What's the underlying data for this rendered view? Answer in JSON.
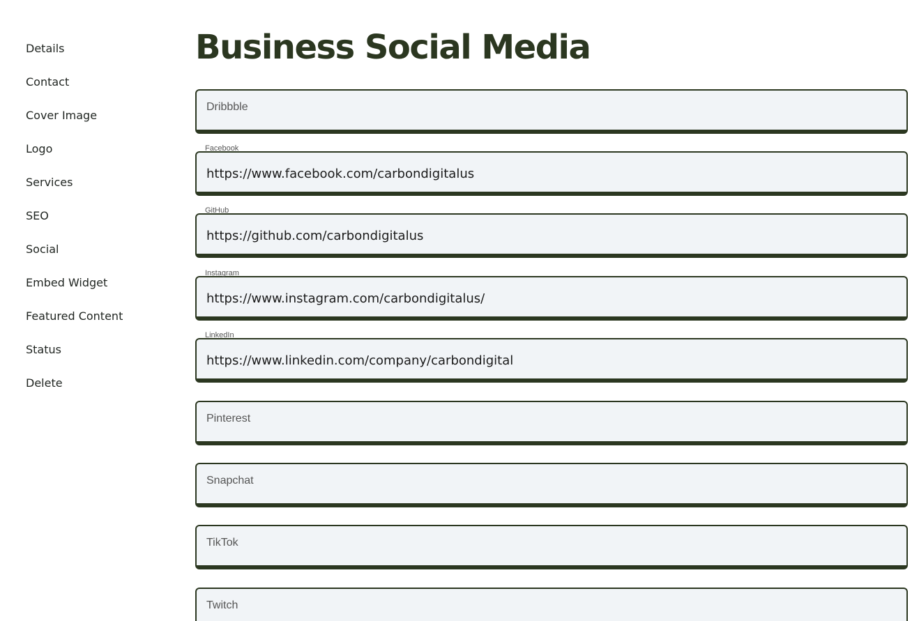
{
  "sidebar": {
    "items": [
      {
        "label": "Details"
      },
      {
        "label": "Contact"
      },
      {
        "label": "Cover Image"
      },
      {
        "label": "Logo"
      },
      {
        "label": "Services"
      },
      {
        "label": "SEO"
      },
      {
        "label": "Social"
      },
      {
        "label": "Embed Widget"
      },
      {
        "label": "Featured Content"
      },
      {
        "label": "Status"
      },
      {
        "label": "Delete"
      }
    ]
  },
  "main": {
    "title": "Business Social Media",
    "fields": [
      {
        "label": "Dribbble",
        "placeholder": "Dribbble",
        "value": ""
      },
      {
        "label": "Facebook",
        "placeholder": "Facebook",
        "value": "https://www.facebook.com/carbondigitalus"
      },
      {
        "label": "GitHub",
        "placeholder": "GitHub",
        "value": "https://github.com/carbondigitalus"
      },
      {
        "label": "Instagram",
        "placeholder": "Instagram",
        "value": "https://www.instagram.com/carbondigitalus/"
      },
      {
        "label": "LinkedIn",
        "placeholder": "LinkedIn",
        "value": "https://www.linkedin.com/company/carbondigital"
      },
      {
        "label": "Pinterest",
        "placeholder": "Pinterest",
        "value": ""
      },
      {
        "label": "Snapchat",
        "placeholder": "Snapchat",
        "value": ""
      },
      {
        "label": "TikTok",
        "placeholder": "TikTok",
        "value": ""
      },
      {
        "label": "Twitch",
        "placeholder": "Twitch",
        "value": ""
      }
    ]
  },
  "colors": {
    "accent": "#2b3720",
    "field_background": "#f1f4f7"
  }
}
